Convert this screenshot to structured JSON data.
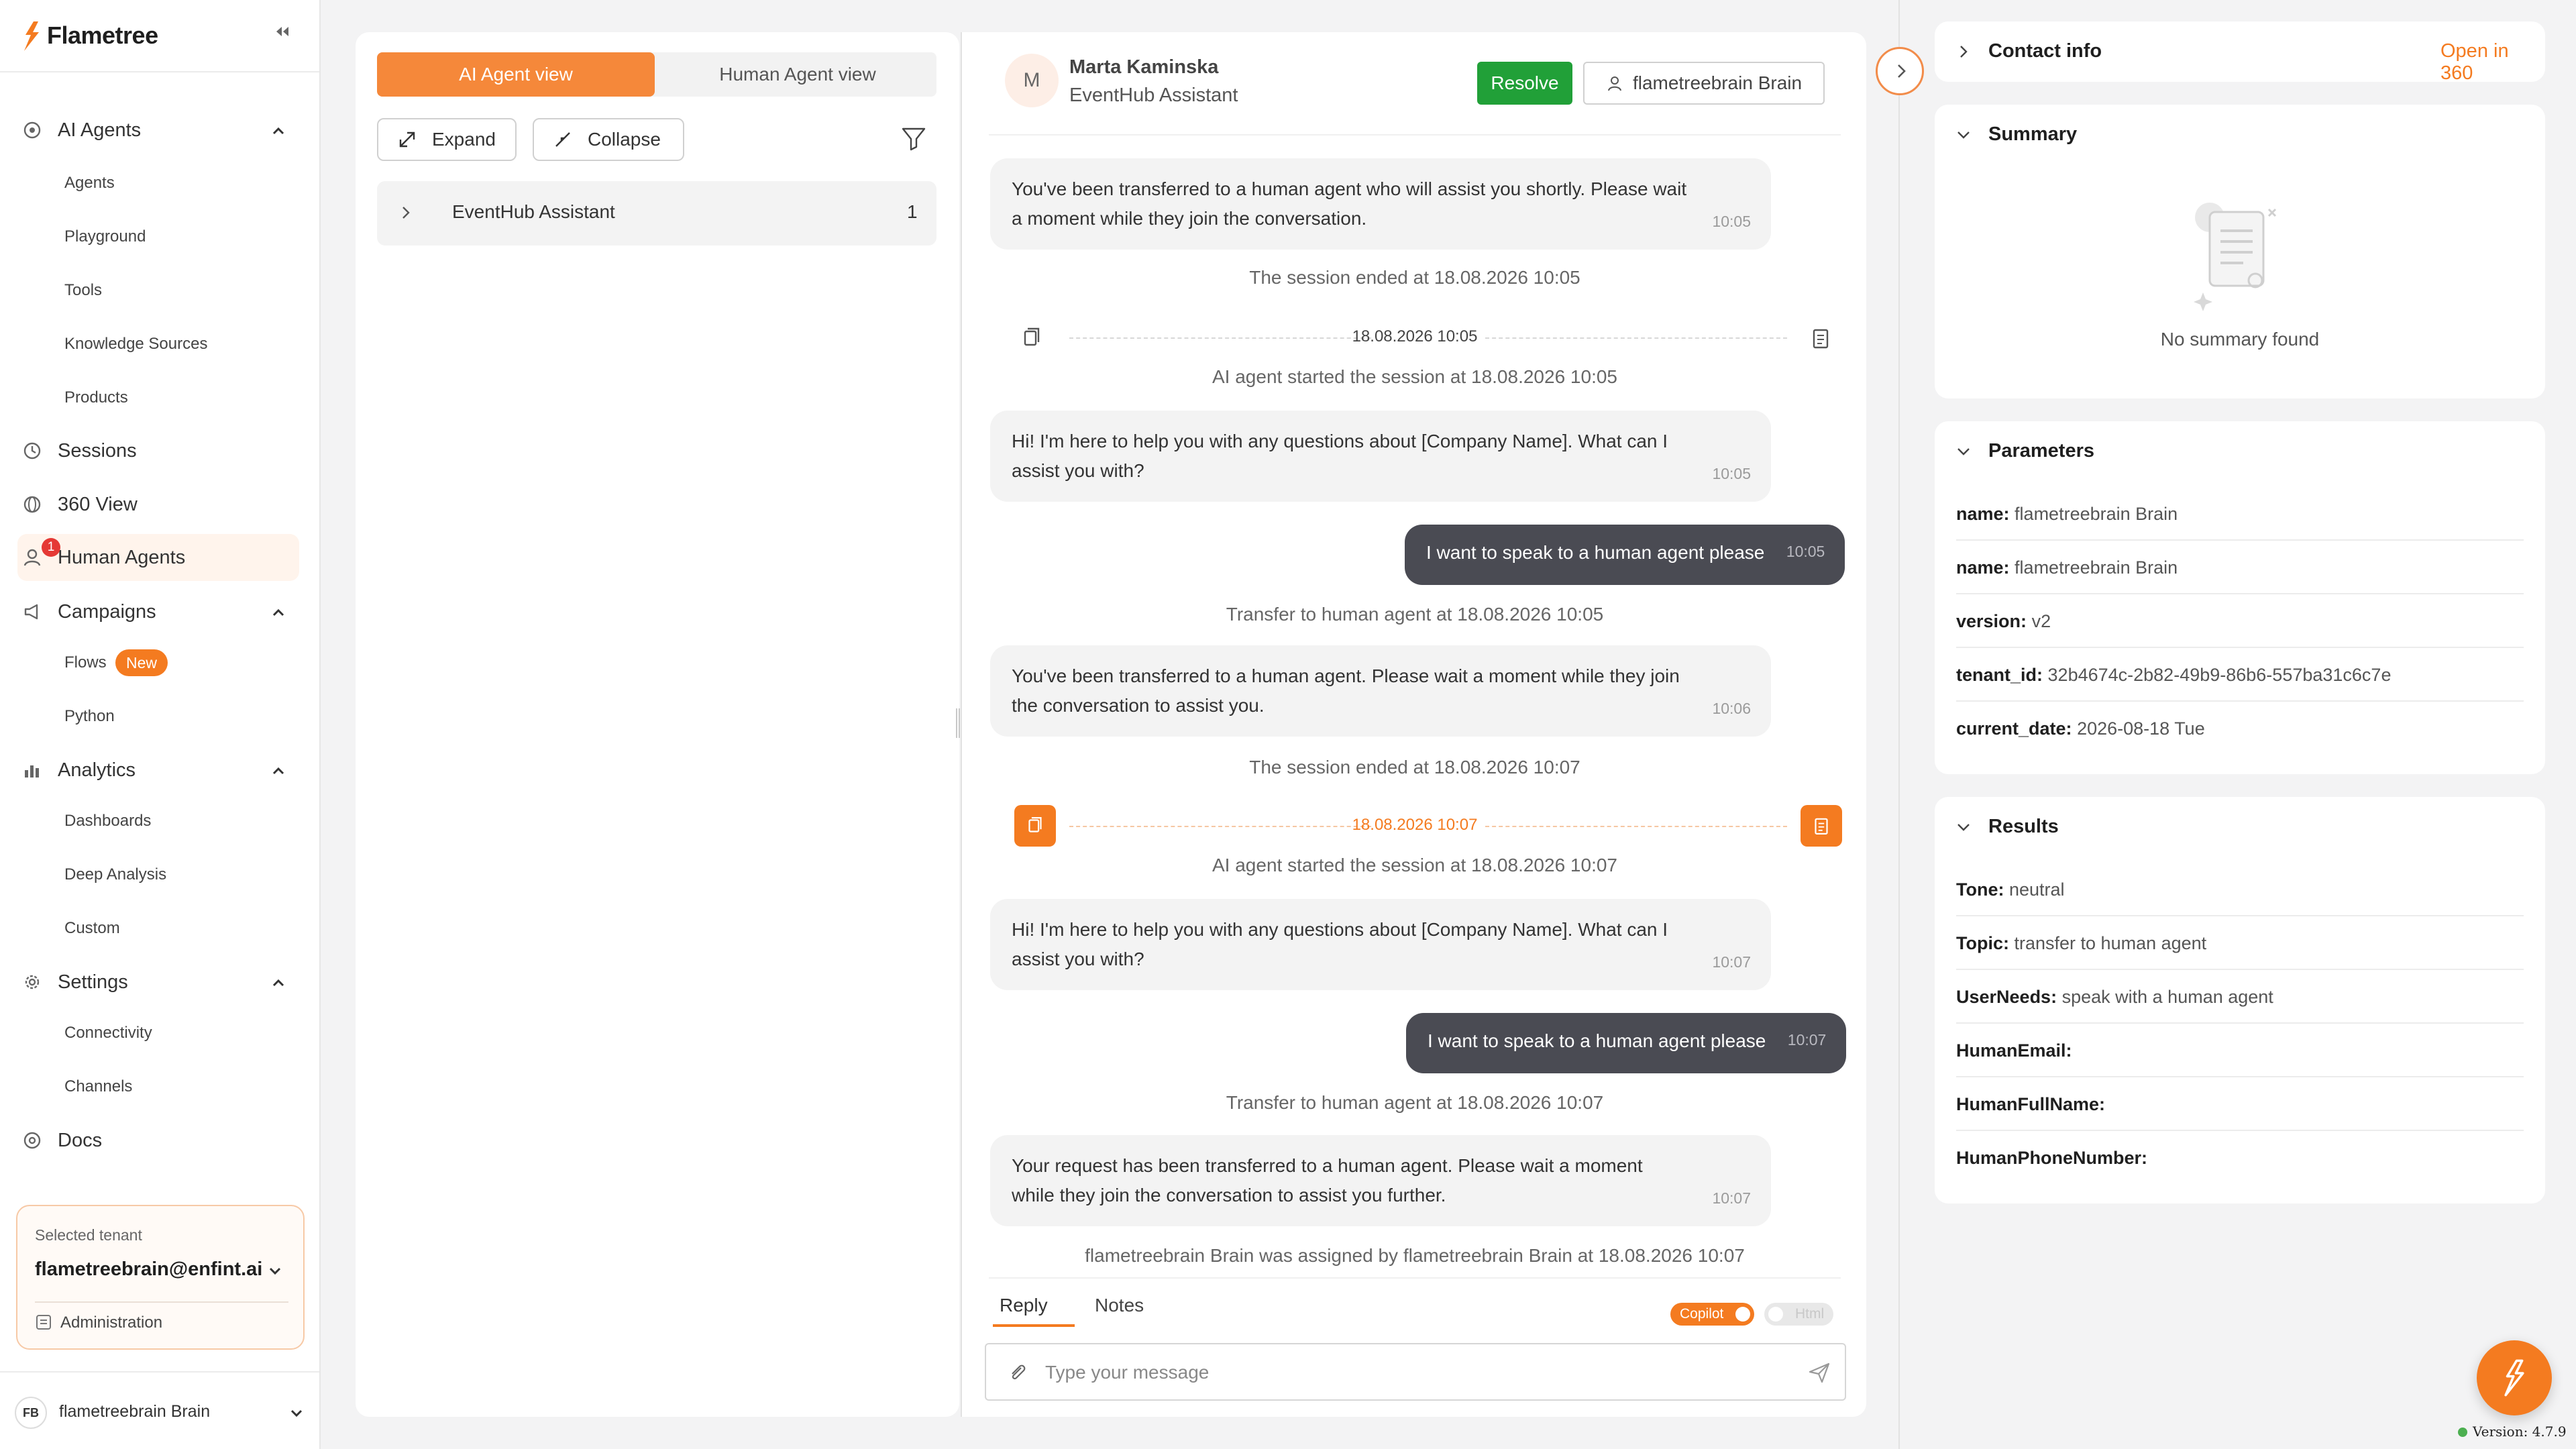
{
  "app": {
    "name": "Flametree",
    "version_text": "Version: 4.7.9"
  },
  "colors": {
    "accent": "#f47b20",
    "resolve": "#21a038",
    "outgoing_bubble": "#4a4b53",
    "notification": "#e53935"
  },
  "sidebar": {
    "sections": [
      {
        "label": "AI Agents",
        "icon": "ai-agents-icon",
        "expanded": true,
        "items": [
          "Agents",
          "Playground",
          "Tools",
          "Knowledge Sources",
          "Products"
        ]
      },
      {
        "label": "Sessions",
        "icon": "sessions-icon"
      },
      {
        "label": "360 View",
        "icon": "view-360-icon"
      },
      {
        "label": "Human Agents",
        "icon": "human-agents-icon",
        "active": true,
        "badge": "1"
      },
      {
        "label": "Campaigns",
        "icon": "megaphone-icon",
        "expanded": true,
        "items": [
          "Flows",
          "Python"
        ],
        "flows_badge": "New"
      },
      {
        "label": "Analytics",
        "icon": "bar-chart-icon",
        "expanded": true,
        "items": [
          "Dashboards",
          "Deep Analysis",
          "Custom"
        ]
      },
      {
        "label": "Settings",
        "icon": "gear-icon",
        "expanded": true,
        "items": [
          "Connectivity",
          "Channels"
        ]
      },
      {
        "label": "Docs",
        "icon": "docs-icon"
      }
    ],
    "tenant": {
      "label": "Selected tenant",
      "value": "flametreebrain@enfint.ai",
      "admin_label": "Administration"
    },
    "user": {
      "initials": "FB",
      "name": "flametreebrain Brain"
    }
  },
  "list_panel": {
    "tabs": [
      "AI Agent view",
      "Human Agent view"
    ],
    "active_tab": "AI Agent view",
    "expand_label": "Expand",
    "collapse_label": "Collapse",
    "groups": [
      {
        "name": "EventHub Assistant",
        "count": "1"
      }
    ]
  },
  "chat": {
    "contact_initial": "M",
    "contact_name": "Marta Kaminska",
    "assistant_name": "EventHub Assistant",
    "resolve_label": "Resolve",
    "assignee": "flametreebrain Brain",
    "messages": [
      {
        "type": "in",
        "text": "You've been transferred to a human agent who will assist you shortly. Please wait a moment while they join the conversation.",
        "time": "10:05"
      },
      {
        "type": "system",
        "text": "The session ended at 18.08.2026 10:05"
      },
      {
        "type": "date",
        "text": "18.08.2026 10:05"
      },
      {
        "type": "system",
        "text": "AI agent started the session at 18.08.2026 10:05"
      },
      {
        "type": "in",
        "text": "Hi! I'm here to help you with any questions about [Company Name]. What can I assist you with?",
        "time": "10:05"
      },
      {
        "type": "out",
        "text": "I want to speak to a human agent please",
        "time": "10:05"
      },
      {
        "type": "system",
        "text": "Transfer to human agent at 18.08.2026 10:05"
      },
      {
        "type": "in",
        "text": "You've been transferred to a human agent. Please wait a moment while they join the conversation to assist you.",
        "time": "10:06"
      },
      {
        "type": "system",
        "text": "The session ended at 18.08.2026 10:07"
      },
      {
        "type": "date",
        "text": "18.08.2026 10:07",
        "highlighted": true
      },
      {
        "type": "system",
        "text": "AI agent started the session at 18.08.2026 10:07"
      },
      {
        "type": "in",
        "text": "Hi! I'm here to help you with any questions about [Company Name]. What can I assist you with?",
        "time": "10:07"
      },
      {
        "type": "out",
        "text": "I want to speak to a human agent please",
        "time": "10:07"
      },
      {
        "type": "system",
        "text": "Transfer to human agent at 18.08.2026 10:07"
      },
      {
        "type": "in",
        "text": "Your request has been transferred to a human agent. Please wait a moment while they join the conversation to assist you further.",
        "time": "10:07"
      },
      {
        "type": "system",
        "text": "flametreebrain Brain was assigned by flametreebrain Brain at 18.08.2026 10:07"
      }
    ],
    "reply_tabs": [
      "Reply",
      "Notes"
    ],
    "active_reply_tab": "Reply",
    "copilot_label": "Copilot",
    "copilot_on": true,
    "html_label": "Html",
    "html_on": false,
    "input_placeholder": "Type your message",
    "input_value": ""
  },
  "right_panel": {
    "contact_info": {
      "title": "Contact info",
      "link": "Open in 360"
    },
    "summary": {
      "title": "Summary",
      "empty_text": "No summary found"
    },
    "parameters": {
      "title": "Parameters",
      "rows": [
        {
          "key": "name:",
          "value": "flametreebrain Brain"
        },
        {
          "key": "name:",
          "value": "flametreebrain Brain"
        },
        {
          "key": "version:",
          "value": "v2"
        },
        {
          "key": "tenant_id:",
          "value": "32b4674c-2b82-49b9-86b6-557ba31c6c7e"
        },
        {
          "key": "current_date:",
          "value": "2026-08-18 Tue"
        }
      ]
    },
    "results": {
      "title": "Results",
      "rows": [
        {
          "key": "Tone:",
          "value": "neutral"
        },
        {
          "key": "Topic:",
          "value": "transfer to human agent"
        },
        {
          "key": "UserNeeds:",
          "value": "speak with a human agent"
        },
        {
          "key": "HumanEmail:",
          "value": ""
        },
        {
          "key": "HumanFullName:",
          "value": ""
        },
        {
          "key": "HumanPhoneNumber:",
          "value": ""
        }
      ]
    }
  }
}
